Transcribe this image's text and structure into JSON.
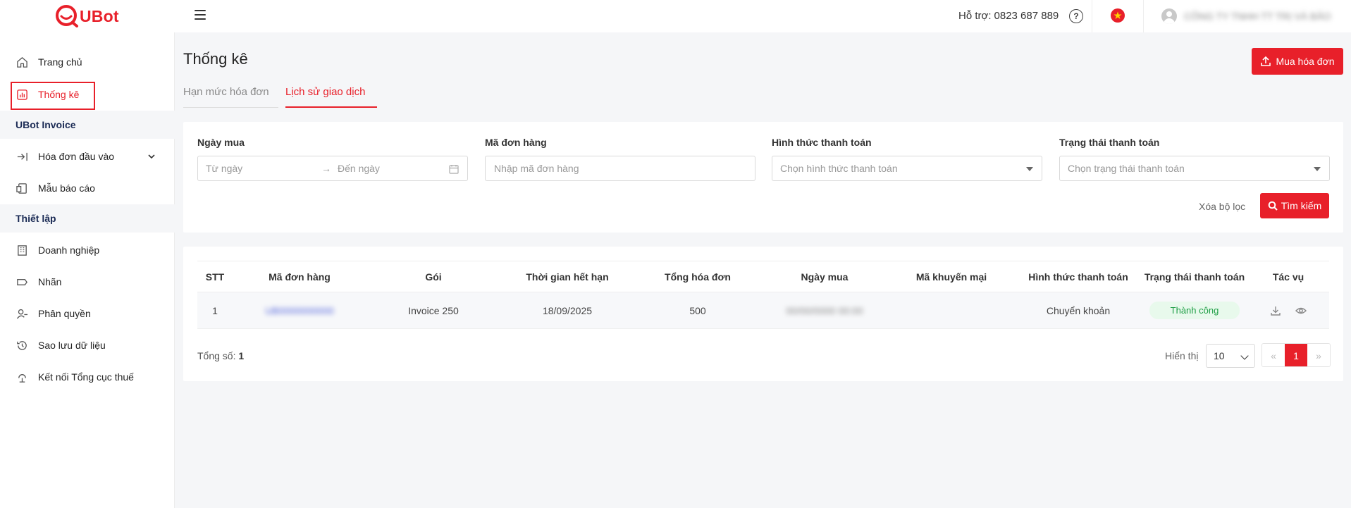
{
  "brand": {
    "name": "UBot",
    "color": "#e8202a"
  },
  "header": {
    "support_label": "Hỗ trợ:",
    "support_phone": "0823 687 889",
    "help_icon": "question-circle-icon",
    "language_icon": "vietnam-flag-icon",
    "account_name": "CÔNG TY TNHH TT TRỊ VÀ BẢO"
  },
  "sidebar": {
    "items": [
      {
        "label": "Trang chủ",
        "icon": "home-icon"
      },
      {
        "label": "Thống kê",
        "icon": "bar-chart-icon",
        "active": true
      }
    ],
    "section_invoice": "UBot Invoice",
    "invoice_items": [
      {
        "label": "Hóa đơn đầu vào",
        "icon": "login-arrow-icon",
        "has_submenu": true
      },
      {
        "label": "Mẫu báo cáo",
        "icon": "report-template-icon"
      }
    ],
    "section_settings": "Thiết lập",
    "settings_items": [
      {
        "label": "Doanh nghiệp",
        "icon": "building-icon"
      },
      {
        "label": "Nhãn",
        "icon": "tag-icon"
      },
      {
        "label": "Phân quyền",
        "icon": "user-permission-icon"
      },
      {
        "label": "Sao lưu dữ liệu",
        "icon": "history-icon"
      },
      {
        "label": "Kết nối Tổng cục thuế",
        "icon": "connect-icon"
      }
    ]
  },
  "main": {
    "title": "Thống kê",
    "buy_button": "Mua hóa đơn",
    "tabs": [
      {
        "label": "Hạn mức hóa đơn",
        "active": false
      },
      {
        "label": "Lịch sử giao dịch",
        "active": true
      }
    ]
  },
  "filters": {
    "purchase_date": {
      "label": "Ngày mua",
      "from_placeholder": "Từ ngày",
      "to_placeholder": "Đến ngày"
    },
    "order_code": {
      "label": "Mã đơn hàng",
      "placeholder": "Nhập mã đơn hàng"
    },
    "payment_method": {
      "label": "Hình thức thanh toán",
      "placeholder": "Chọn hình thức thanh toán"
    },
    "payment_status": {
      "label": "Trạng thái thanh toán",
      "placeholder": "Chọn trạng thái thanh toán"
    },
    "clear_label": "Xóa bộ lọc",
    "search_label": "Tìm kiếm"
  },
  "table": {
    "columns": [
      "STT",
      "Mã đơn hàng",
      "Gói",
      "Thời gian hết hạn",
      "Tổng hóa đơn",
      "Ngày mua",
      "Mã khuyến mại",
      "Hình thức thanh toán",
      "Trạng thái thanh toán",
      "Tác vụ"
    ],
    "rows": [
      {
        "stt": "1",
        "order_code": "UB0000000000",
        "package": "Invoice 250",
        "expiry": "18/09/2025",
        "total_invoices": "500",
        "purchase_date": "00/00/0000 00:00",
        "promo_code": "",
        "payment_method": "Chuyển khoản",
        "status": "Thành công",
        "status_color": "#1e9e45"
      }
    ],
    "total_label": "Tổng số:",
    "total_value": "1",
    "show_label": "Hiển thị",
    "page_size": "10",
    "pagination": {
      "prev": "«",
      "current": "1",
      "next": "»"
    }
  }
}
